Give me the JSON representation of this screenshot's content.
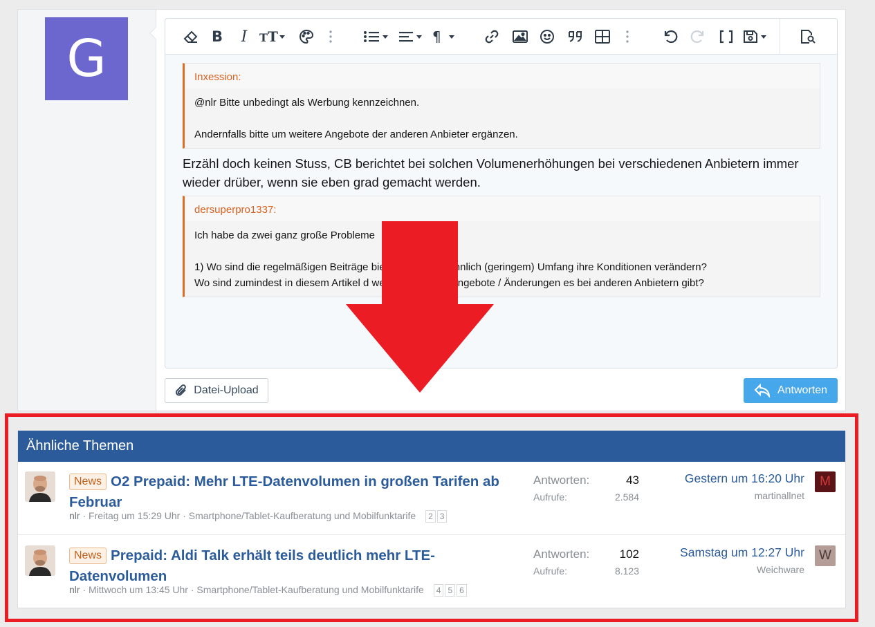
{
  "poster": {
    "avatar_letter": "G",
    "avatar_color": "#6b67cf"
  },
  "toolbar": {
    "icons": [
      "eraser-icon",
      "bold-icon",
      "italic-icon",
      "font-size-icon",
      "palette-icon",
      "more-vertical-icon",
      "list-icon",
      "align-icon",
      "paragraph-icon",
      "link-icon",
      "image-icon",
      "smiley-icon",
      "quote-icon",
      "table-icon",
      "more-vertical-icon",
      "undo-icon",
      "redo-icon",
      "brackets-icon",
      "save-draft-icon",
      "preview-icon"
    ]
  },
  "editor": {
    "quote1": {
      "author": "Inxession:",
      "lines": [
        "@nlr Bitte unbedingt als Werbung kennzeichnen.",
        "",
        "Andernfalls bitte um weitere Angebote der anderen Anbieter ergänzen."
      ]
    },
    "reply_text": "Erzähl doch keinen Stuss, CB berichtet bei solchen Volumenerhöhungen bei verschiedenen Anbietern immer wieder drüber, wenn sie eben grad gemacht werden.",
    "quote2": {
      "author": "dersuperpro1337:",
      "line1": "Ich habe da zwei ganz große Probleme",
      "line2": "1) Wo sind die regelmäßigen Beiträge bieter, welche in ähnlich (geringem) Umfang ihre Konditionen verändern?",
      "line3": "Wo sind zumindest in diesem Artikel d welche aktuellen Angebote / Änderungen es bei anderen Anbietern gibt?"
    }
  },
  "buttons": {
    "upload": "Datei-Upload",
    "reply": "Antworten"
  },
  "similar": {
    "heading": "Ähnliche Themen",
    "threads": [
      {
        "badge": "News",
        "title": "O2 Prepaid: Mehr LTE-Datenvolumen in großen Tarifen ab Februar",
        "author": "nlr",
        "date": "Freitag um 15:29 Uhr",
        "forum": "Smartphone/Tablet-Kaufberatung und Mobilfunktarife",
        "pages": [
          "2",
          "3"
        ],
        "replies_label": "Antworten:",
        "replies": "43",
        "views_label": "Aufrufe:",
        "views": "2.584",
        "last_time": "Gestern um 16:20 Uhr",
        "last_user": "martinallnet",
        "last_avatar_letter": "M",
        "last_avatar_bg": "#5a1417",
        "last_avatar_fg": "#d23a3a"
      },
      {
        "badge": "News",
        "title": "Prepaid: Aldi Talk erhält teils deutlich mehr LTE-Datenvolumen",
        "author": "nlr",
        "date": "Mittwoch um 13:45 Uhr",
        "forum": "Smartphone/Tablet-Kaufberatung und Mobilfunktarife",
        "pages": [
          "4",
          "5",
          "6"
        ],
        "replies_label": "Antworten:",
        "replies": "102",
        "views_label": "Aufrufe:",
        "views": "8.123",
        "last_time": "Samstag um 12:27 Uhr",
        "last_user": "Weichware",
        "last_avatar_letter": "W",
        "last_avatar_bg": "#b49c97",
        "last_avatar_fg": "#4a3a38"
      }
    ]
  },
  "colors": {
    "highlight": "#ec1c24",
    "link": "#2b5b9a",
    "quote_accent": "#e06c23",
    "reply_button": "#47a7eb"
  }
}
